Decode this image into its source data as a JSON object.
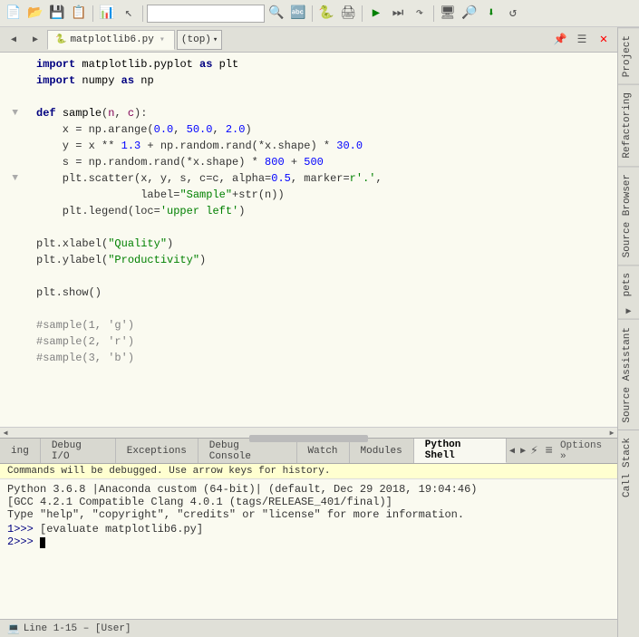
{
  "toolbar": {
    "icons": [
      "new-file",
      "open",
      "save",
      "save-as",
      "chart",
      "cursor",
      "search",
      "find-replace",
      "python",
      "print",
      "run",
      "step-over",
      "step-into",
      "monitor",
      "search2",
      "download",
      "refresh"
    ],
    "search_placeholder": "",
    "file_tab": "matplotlib6.py",
    "dropdown": "(top)"
  },
  "editor": {
    "lines": [
      {
        "num": "",
        "arrow": "",
        "content": "import matplotlib.pyplot as plt",
        "tokens": [
          {
            "t": "import",
            "c": "kw"
          },
          {
            "t": " matplotlib.pyplot ",
            "c": "var"
          },
          {
            "t": "as",
            "c": "kw"
          },
          {
            "t": " plt",
            "c": "var"
          }
        ]
      },
      {
        "num": "",
        "arrow": "",
        "content": "import numpy as np",
        "tokens": [
          {
            "t": "import",
            "c": "kw"
          },
          {
            "t": " numpy ",
            "c": "var"
          },
          {
            "t": "as",
            "c": "kw"
          },
          {
            "t": " np",
            "c": "var"
          }
        ]
      },
      {
        "num": "",
        "arrow": "",
        "content": ""
      },
      {
        "num": "",
        "arrow": "▼",
        "content": "def sample(n, c):",
        "tokens": [
          {
            "t": "def",
            "c": "kw"
          },
          {
            "t": " sample",
            "c": "fn"
          },
          {
            "t": "(",
            "c": "var"
          },
          {
            "t": "n",
            "c": "param"
          },
          {
            "t": ", ",
            "c": "var"
          },
          {
            "t": "c",
            "c": "param"
          },
          {
            "t": "):",
            "c": "var"
          }
        ]
      },
      {
        "num": "",
        "arrow": "",
        "content": "    x = np.arange(0.0, 50.0, 2.0)",
        "tokens": [
          {
            "t": "    x = np.arange(",
            "c": "var"
          },
          {
            "t": "0.0",
            "c": "num"
          },
          {
            "t": ", ",
            "c": "var"
          },
          {
            "t": "50.0",
            "c": "num"
          },
          {
            "t": ", ",
            "c": "var"
          },
          {
            "t": "2.0",
            "c": "num"
          },
          {
            "t": ")",
            "c": "var"
          }
        ]
      },
      {
        "num": "",
        "arrow": "",
        "content": "    y = x ** 1.3 + np.random.rand(*x.shape) * 30.0",
        "tokens": [
          {
            "t": "    y = x ** ",
            "c": "var"
          },
          {
            "t": "1.3",
            "c": "num"
          },
          {
            "t": " + np.random.rand(*x.shape) * ",
            "c": "var"
          },
          {
            "t": "30.0",
            "c": "num"
          }
        ]
      },
      {
        "num": "",
        "arrow": "",
        "content": "    s = np.random.rand(*x.shape) * 800 + 500",
        "tokens": [
          {
            "t": "    s = np.random.rand(*x.shape) * ",
            "c": "var"
          },
          {
            "t": "800",
            "c": "num"
          },
          {
            "t": " + ",
            "c": "var"
          },
          {
            "t": "500",
            "c": "num"
          }
        ]
      },
      {
        "num": "",
        "arrow": "▼",
        "content": "    plt.scatter(x, y, s, c=c, alpha=0.5, marker='.',",
        "tokens": [
          {
            "t": "    plt.scatter(x, y, s, c=c, alpha=",
            "c": "var"
          },
          {
            "t": "0.5",
            "c": "num"
          },
          {
            "t": ", marker=",
            "c": "var"
          },
          {
            "t": "r'.'",
            "c": "str"
          },
          {
            "t": ",",
            "c": "var"
          }
        ]
      },
      {
        "num": "",
        "arrow": "",
        "content": "                label=\"Sample\"+str(n))",
        "tokens": [
          {
            "t": "                label=",
            "c": "var"
          },
          {
            "t": "\"Sample\"",
            "c": "str"
          },
          {
            "t": "+str(n))",
            "c": "var"
          }
        ]
      },
      {
        "num": "",
        "arrow": "",
        "content": "    plt.legend(loc='upper left')",
        "tokens": [
          {
            "t": "    plt.legend(loc=",
            "c": "var"
          },
          {
            "t": "'upper left'",
            "c": "str"
          },
          {
            "t": ")",
            "c": "var"
          }
        ]
      },
      {
        "num": "",
        "arrow": "",
        "content": ""
      },
      {
        "num": "",
        "arrow": "",
        "content": "plt.xlabel(\"Quality\")",
        "tokens": [
          {
            "t": "plt.xlabel(",
            "c": "var"
          },
          {
            "t": "\"Quality\"",
            "c": "str"
          },
          {
            "t": ")",
            "c": "var"
          }
        ]
      },
      {
        "num": "",
        "arrow": "",
        "content": "plt.ylabel(\"Productivity\")",
        "tokens": [
          {
            "t": "plt.ylabel(",
            "c": "var"
          },
          {
            "t": "\"Productivity\"",
            "c": "str"
          },
          {
            "t": ")",
            "c": "var"
          }
        ]
      },
      {
        "num": "",
        "arrow": "",
        "content": ""
      },
      {
        "num": "",
        "arrow": "",
        "content": "plt.show()",
        "tokens": [
          {
            "t": "plt.show()",
            "c": "var"
          }
        ]
      },
      {
        "num": "",
        "arrow": "",
        "content": ""
      },
      {
        "num": "",
        "arrow": "",
        "content": "#sample(1, 'g')",
        "tokens": [
          {
            "t": "#sample(1, 'g')",
            "c": "comment"
          }
        ]
      },
      {
        "num": "",
        "arrow": "",
        "content": "#sample(2, 'r')",
        "tokens": [
          {
            "t": "#sample(2, 'r')",
            "c": "comment"
          }
        ]
      },
      {
        "num": "",
        "arrow": "",
        "content": "#sample(3, 'b')",
        "tokens": [
          {
            "t": "#sample(3, 'b')",
            "c": "comment"
          }
        ]
      }
    ]
  },
  "bottom_tabs": [
    {
      "label": "ing",
      "active": false
    },
    {
      "label": "Debug I/O",
      "active": false
    },
    {
      "label": "Exceptions",
      "active": false
    },
    {
      "label": "Debug Console",
      "active": false
    },
    {
      "label": "Watch",
      "active": false
    },
    {
      "label": "Modules",
      "active": false
    },
    {
      "label": "Python Shell",
      "active": true
    }
  ],
  "console": {
    "info": "Commands will be debugged.  Use arrow keys for history.",
    "output": "Python 3.6.8 |Anaconda custom (64-bit)| (default, Dec 29 2018, 19:04:46)\n[GCC 4.2.1 Compatible Clang 4.0.1 (tags/RELEASE_401/final)]\nType \"help\", \"copyright\", \"credits\" or \"license\" for more information.",
    "history": [
      {
        "prompt": "1>>>",
        "cmd": "[evaluate matplotlib6.py]"
      },
      {
        "prompt": "2>>>",
        "cmd": ""
      }
    ]
  },
  "right_sidebar": {
    "tabs": [
      "Project",
      "Refactoring",
      "Source Browser",
      "pets",
      "Source Assistant",
      "Call Stack"
    ]
  },
  "status_bar": {
    "text": "Line 1-15 – [User]"
  },
  "options_label": "Options »"
}
